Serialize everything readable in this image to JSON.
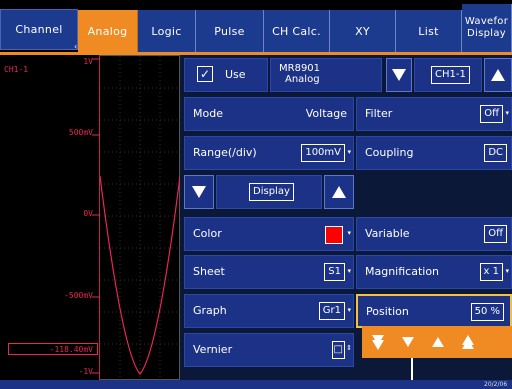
{
  "tabs": {
    "channel": "Channel",
    "analog": "Analog",
    "logic": "Logic",
    "pulse": "Pulse",
    "chcalc": "CH Calc.",
    "xy": "XY",
    "list": "List",
    "wave_line1": "Wavefor",
    "wave_line2": "Display"
  },
  "waveform": {
    "channel": "CH1-1",
    "top": "1V",
    "p500": "500mV",
    "zero": "0V",
    "m500": "-500mV",
    "cursor_value": "-118.40mV",
    "bottom": "-1V",
    "trace_color": "#e8265a"
  },
  "settings": {
    "use_label": "Use",
    "use_checked": true,
    "module_line1": "MR8901",
    "module_line2": "Analog",
    "channel_select": "CH1-1",
    "mode_label": "Mode",
    "mode_value": "Voltage",
    "filter_label": "Filter",
    "filter_value": "Off",
    "range_label": "Range(/div)",
    "range_value": "100mV",
    "coupling_label": "Coupling",
    "coupling_value": "DC",
    "display_label": "Display",
    "color_label": "Color",
    "color_value": "#ff0000",
    "variable_label": "Variable",
    "variable_value": "Off",
    "sheet_label": "Sheet",
    "sheet_value": "S1",
    "magnification_label": "Magnification",
    "magnification_value": "x 1",
    "graph_label": "Graph",
    "graph_value": "Gr1",
    "position_label": "Position",
    "position_value": "50 %",
    "vernier_label": "Vernier"
  },
  "status": {
    "date": "20/2/06"
  },
  "colors": {
    "accent": "#f08a22",
    "panel": "#1b3287",
    "trace": "#e8265a"
  }
}
